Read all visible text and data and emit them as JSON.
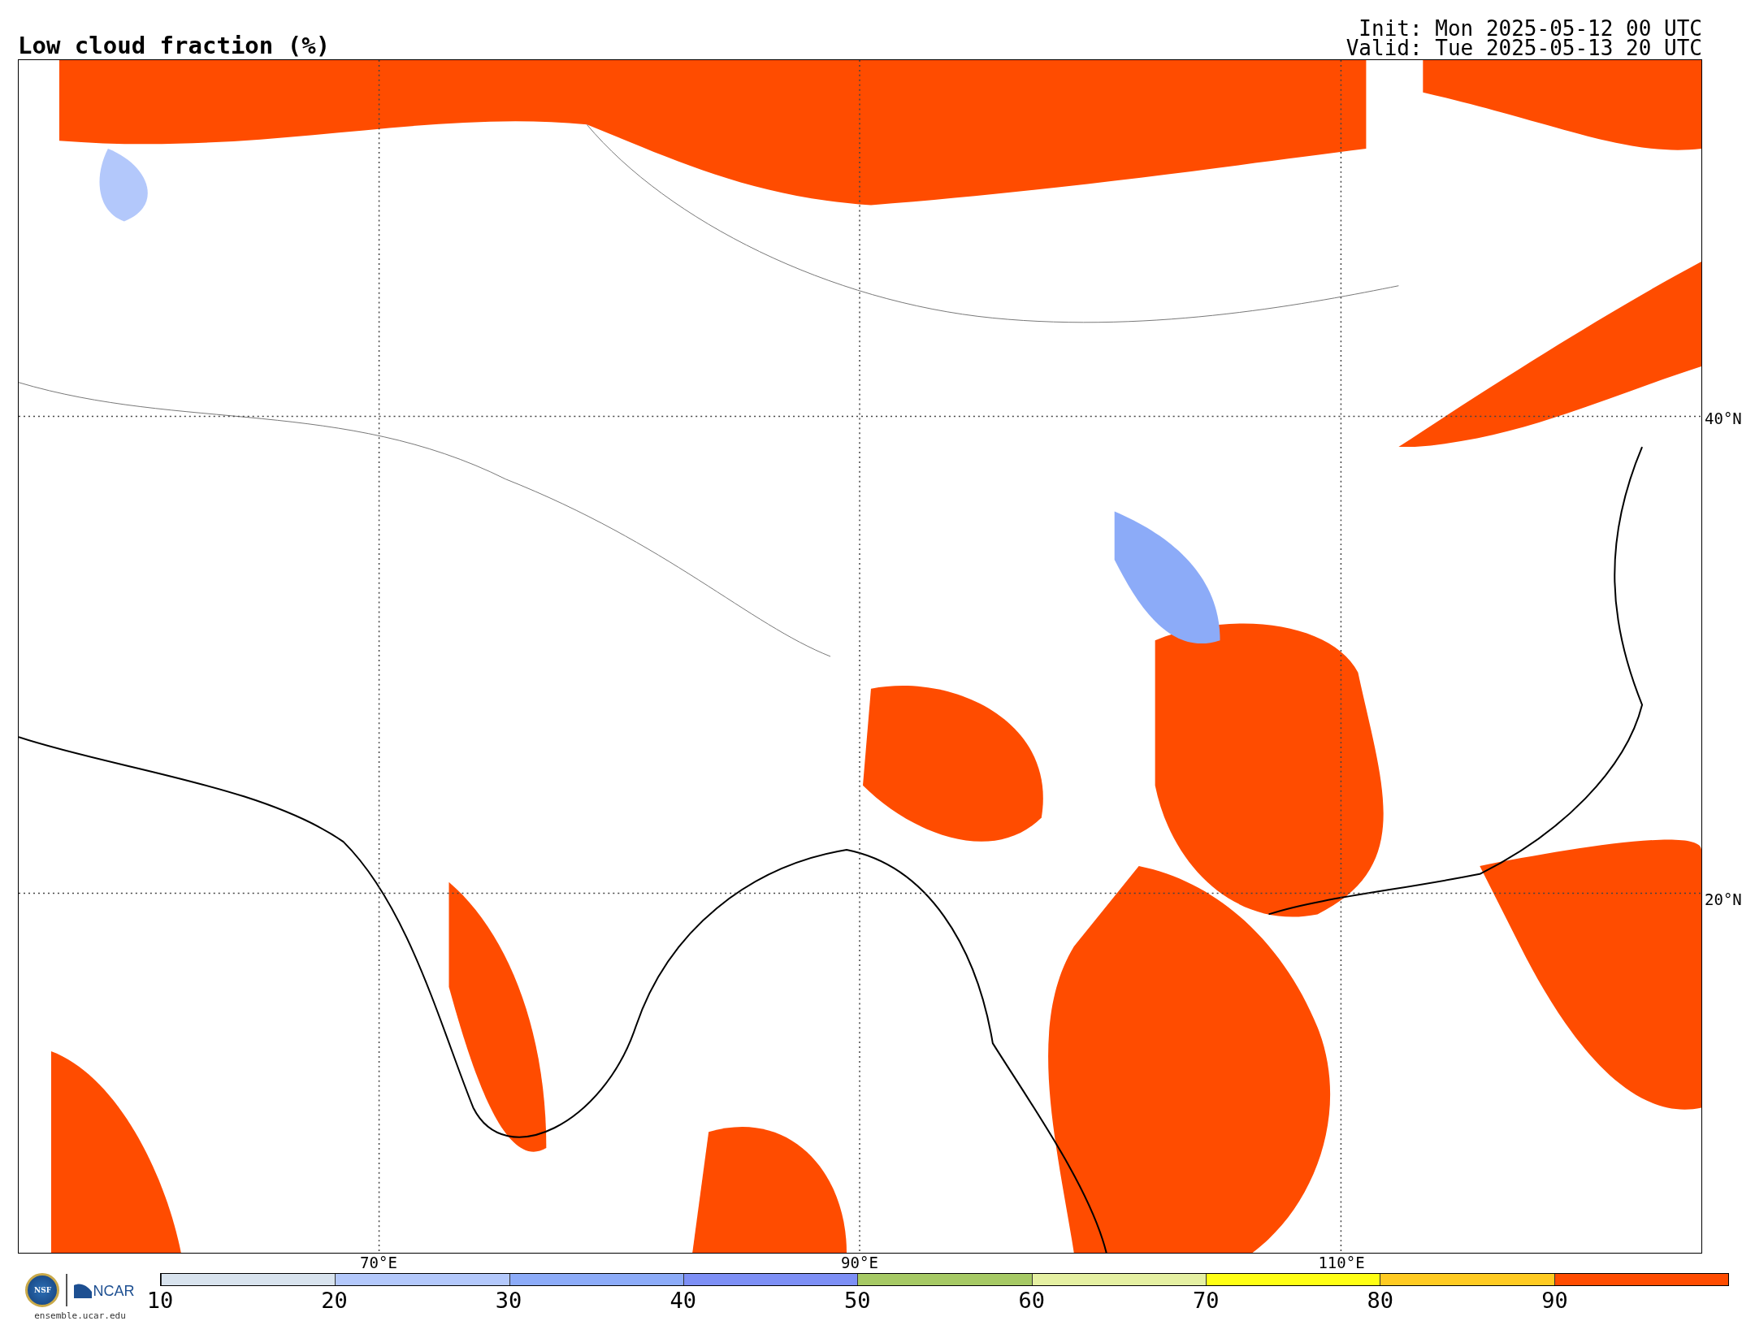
{
  "title": "Low cloud fraction (%)",
  "init": "Init: Mon 2025-05-12 00 UTC",
  "valid": "Valid: Tue 2025-05-13 20 UTC",
  "map": {
    "lat_labels": [
      "40°N",
      "20°N"
    ],
    "lon_labels": [
      "70°E",
      "90°E",
      "110°E"
    ]
  },
  "logos": {
    "nsf": "NSF",
    "ncar": "NCAR",
    "site": "ensemble.ucar.edu"
  },
  "colorbar": {
    "ticks": [
      "10",
      "20",
      "30",
      "40",
      "50",
      "60",
      "70",
      "80",
      "90"
    ],
    "segments": [
      {
        "color": "#d8e3ee"
      },
      {
        "color": "#b3c8fb"
      },
      {
        "color": "#8cabf8"
      },
      {
        "color": "#7d8ff5"
      },
      {
        "color": "#a6c964"
      },
      {
        "color": "#e5f0a2"
      },
      {
        "color": "#ffff14"
      },
      {
        "color": "#ffcb22"
      },
      {
        "color": "#ff4c00"
      }
    ]
  }
}
